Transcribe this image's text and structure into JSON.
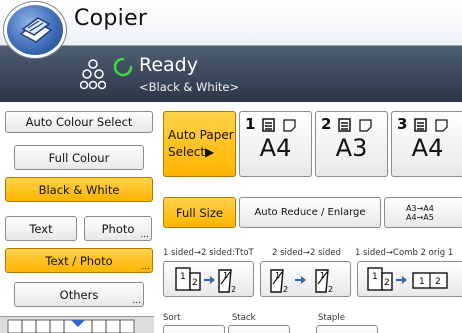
{
  "app": {
    "title": "Copier"
  },
  "status": {
    "main": "Ready",
    "sub": "<Black & White>"
  },
  "colour_modes": [
    {
      "label": "Auto Colour Select",
      "selected": false
    },
    {
      "label": "Full Colour",
      "selected": false
    },
    {
      "label": "Black & White",
      "selected": true
    }
  ],
  "original_type": {
    "text_label": "Text",
    "photo_label": "Photo",
    "text_photo_label": "Text / Photo",
    "text_photo_selected": true,
    "others_label": "Others",
    "more_mark": "..."
  },
  "paper": {
    "auto_label": "Auto Paper Select▶",
    "auto_selected": true,
    "trays": [
      {
        "number": "1",
        "size": "A4"
      },
      {
        "number": "2",
        "size": "A3"
      },
      {
        "number": "3",
        "size": "A4"
      }
    ]
  },
  "reduce_enlarge": {
    "full_size_label": "Full Size",
    "full_size_selected": true,
    "auto_label": "Auto Reduce / Enlarge",
    "preset_line1": "A3→A4",
    "preset_line2": "A4→A5"
  },
  "duplex": {
    "labels": [
      "1 sided→2 sided:TtoT",
      "2 sided→2 sided",
      "1 sided→Comb 2 orig 1"
    ]
  },
  "finishing": {
    "labels": [
      "Sort",
      "Stack",
      "Staple"
    ]
  },
  "colors": {
    "selected": "#ffbe14",
    "status_bar": "#3a465a",
    "icon_blue": "#3f6db7"
  }
}
